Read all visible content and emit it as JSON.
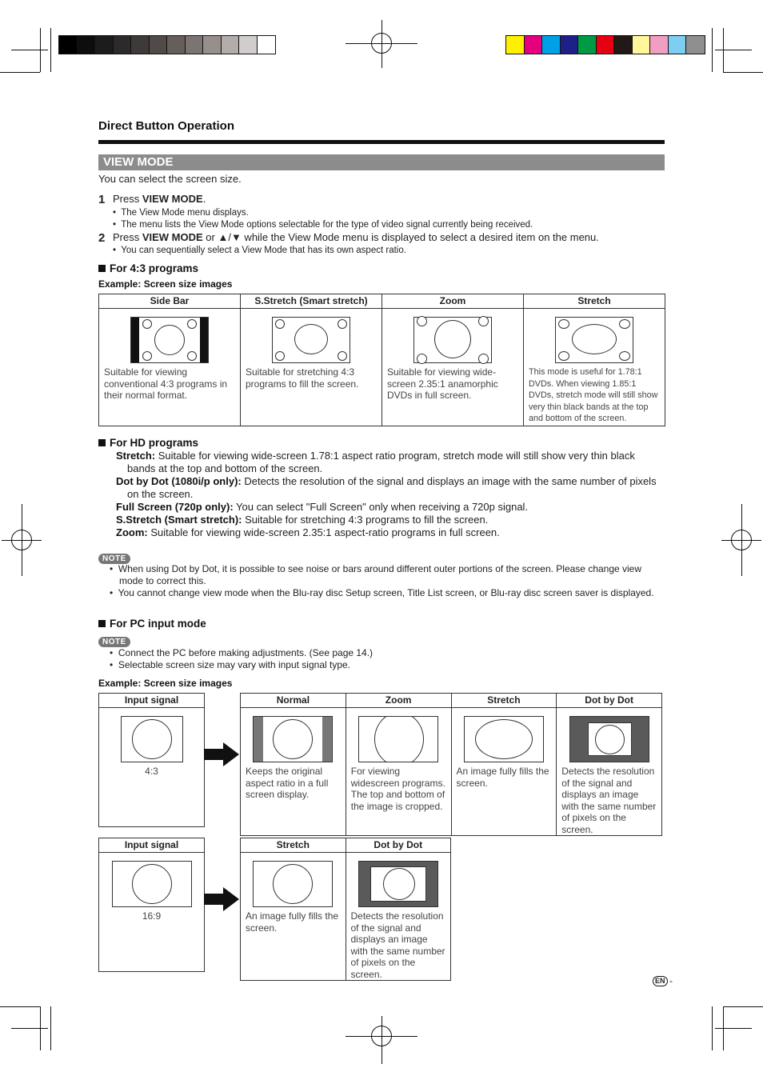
{
  "print_marks": {
    "grayscale_swatches": [
      "#000000",
      "#0d0d0d",
      "#1c1c1c",
      "#2c2a2a",
      "#3d3a39",
      "#504a48",
      "#655e5b",
      "#7c7472",
      "#968f8c",
      "#b2acaa",
      "#d1cdcc",
      "#ffffff"
    ],
    "color_swatches": [
      "#ffef00",
      "#e6007e",
      "#00a0e9",
      "#1d2088",
      "#009944",
      "#e60012",
      "#231815",
      "#fff799",
      "#f19ec2",
      "#7ecef4",
      "#8f8f8f"
    ]
  },
  "header": {
    "section_title": "Direct Button Operation",
    "band_title": "VIEW MODE",
    "intro": "You can select the screen size."
  },
  "steps": [
    {
      "number": "1",
      "parts": [
        {
          "text": "Press ",
          "bold": false
        },
        {
          "text": "VIEW MODE",
          "bold": true
        },
        {
          "text": ".",
          "bold": false
        }
      ],
      "bullets": [
        "The View Mode menu displays.",
        "The menu lists the View Mode options selectable for the type of video signal currently being received."
      ]
    },
    {
      "number": "2",
      "parts": [
        {
          "text": "Press ",
          "bold": false
        },
        {
          "text": "VIEW MODE",
          "bold": true
        },
        {
          "text": " or ▲/▼ while the View Mode menu is displayed to select a desired item on the menu.",
          "bold": false
        }
      ],
      "bullets": [
        "You can sequentially select a View Mode that has its own aspect ratio."
      ]
    }
  ],
  "for43": {
    "heading": "For 4:3 programs",
    "example_label": "Example: Screen size images",
    "columns": [
      {
        "header": "Side Bar",
        "desc": "Suitable for viewing conventional 4:3 programs in their normal format."
      },
      {
        "header": "S.Stretch (Smart stretch)",
        "desc": "Suitable for stretching 4:3 programs to fill the screen."
      },
      {
        "header": "Zoom",
        "desc": "Suitable for viewing wide-screen 2.35:1 anamorphic DVDs in full screen."
      },
      {
        "header": "Stretch",
        "desc": "This mode is useful for 1.78:1 DVDs. When viewing 1.85:1 DVDs, stretch mode will still show very thin black bands at the top and bottom of the screen."
      }
    ]
  },
  "forHD": {
    "heading": "For HD programs",
    "items": [
      {
        "term": "Stretch:",
        "desc": " Suitable for viewing wide-screen 1.78:1 aspect ratio program, stretch mode will still show very thin black bands at the top and bottom of the screen."
      },
      {
        "term": "Dot by Dot (1080i/p only):",
        "desc": " Detects the resolution of the signal and displays an image with the same number of pixels on the screen."
      },
      {
        "term": "Full Screen (720p only):",
        "desc": " You can select \"Full Screen\" only when receiving a 720p signal."
      },
      {
        "term": "S.Stretch (Smart stretch):",
        "desc": " Suitable for stretching 4:3 programs to fill the screen."
      },
      {
        "term": "Zoom:",
        "desc": " Suitable for viewing wide-screen 2.35:1 aspect-ratio programs in full screen."
      }
    ]
  },
  "note1": {
    "label": "NOTE",
    "bullets": [
      "When using Dot by Dot, it is possible to see noise or bars around different outer portions of the screen. Please change view mode to correct this.",
      "You cannot change view mode when the Blu-ray disc Setup screen, Title List screen, or Blu-ray disc screen saver is displayed."
    ]
  },
  "forPC": {
    "heading": "For PC input mode",
    "note_label": "NOTE",
    "note_bullets": [
      "Connect the PC before making adjustments. (See page 14.)",
      "Selectable screen size may vary with input signal type."
    ],
    "example_label": "Example: Screen size images",
    "table1": {
      "input_header": "Input signal",
      "input_caption": "4:3",
      "columns": [
        {
          "header": "Normal",
          "desc": "Keeps the original aspect ratio in a full screen display."
        },
        {
          "header": "Zoom",
          "desc": "For viewing widescreen programs. The top and bottom of the image is cropped."
        },
        {
          "header": "Stretch",
          "desc": "An image fully fills the screen."
        },
        {
          "header": "Dot by Dot",
          "desc": "Detects the resolution of the signal and displays an image with the same number of pixels on the screen."
        }
      ]
    },
    "table2": {
      "input_header": "Input signal",
      "input_caption": "16:9",
      "columns": [
        {
          "header": "Stretch",
          "desc": "An image fully fills the screen."
        },
        {
          "header": "Dot by Dot",
          "desc": "Detects the resolution of the signal and displays an image with the same number of pixels on the screen."
        }
      ]
    }
  },
  "footer": {
    "lang_badge": "EN",
    "page_suffix": "-"
  }
}
